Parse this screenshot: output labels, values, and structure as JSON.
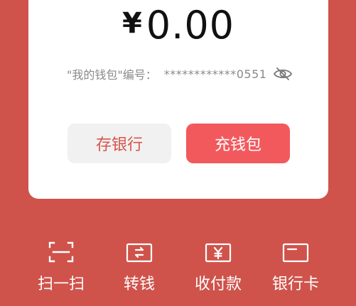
{
  "balance": {
    "currency_symbol": "¥",
    "amount": "0.00"
  },
  "wallet": {
    "number_label": "\"我的钱包\"编号：",
    "number_value": "************0551",
    "visibility_icon": "eye-off-icon"
  },
  "buttons": {
    "save_to_bank": "存银行",
    "top_up_wallet": "充钱包"
  },
  "actions": [
    {
      "label": "扫一扫",
      "icon": "scan-icon"
    },
    {
      "label": "转钱",
      "icon": "transfer-icon"
    },
    {
      "label": "收付款",
      "icon": "payment-icon"
    },
    {
      "label": "银行卡",
      "icon": "bank-card-icon"
    }
  ],
  "colors": {
    "background": "#cf534b",
    "primary_button": "#f2595d",
    "secondary_button": "#f1f1f1",
    "secondary_button_text": "#d8544b"
  }
}
